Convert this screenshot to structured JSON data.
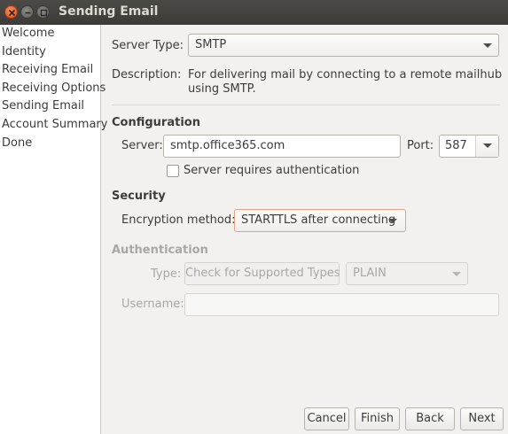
{
  "window": {
    "title": "Sending Email"
  },
  "sidebar": {
    "items": [
      {
        "label": "Welcome"
      },
      {
        "label": "Identity"
      },
      {
        "label": "Receiving Email"
      },
      {
        "label": "Receiving Options"
      },
      {
        "label": "Sending Email"
      },
      {
        "label": "Account Summary"
      },
      {
        "label": "Done"
      }
    ]
  },
  "server_type": {
    "label": "Server Type:",
    "value": "SMTP"
  },
  "description": {
    "label": "Description:",
    "line1": "For delivering mail by connecting to a remote mailhub",
    "line2": "using SMTP."
  },
  "configuration": {
    "heading": "Configuration",
    "server_label": "Server:",
    "server_value": "smtp.office365.com",
    "port_label": "Port:",
    "port_value": "587",
    "auth_checkbox_label": "Server requires authentication",
    "auth_checked": false
  },
  "security": {
    "heading": "Security",
    "encryption_label": "Encryption method:",
    "encryption_value": "STARTTLS after connecting"
  },
  "authentication": {
    "heading": "Authentication",
    "type_label": "Type:",
    "check_button_label": "Check for Supported Types",
    "mechanism_value": "PLAIN",
    "username_label": "Username:",
    "username_value": ""
  },
  "buttons": {
    "cancel": "Cancel",
    "finish": "Finish",
    "back": "Back",
    "next": "Next"
  }
}
